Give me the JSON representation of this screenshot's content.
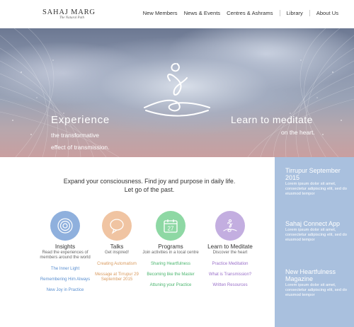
{
  "header": {
    "logo_main": "SAHAJ MARG",
    "logo_sub": "The Natural Path",
    "nav": [
      "New Members",
      "News & Events",
      "Centres & Ashrams",
      "Library",
      "About Us"
    ]
  },
  "hero": {
    "experience": "Experience",
    "experience_line1": "the transformative",
    "experience_line2": "effect of transmission.",
    "learn": "Learn to meditate",
    "learn_sub": "on the heart."
  },
  "intro": {
    "line1": "Expand your consciousness. Find joy and purpose in daily life.",
    "line2": "Let go of the past."
  },
  "columns": [
    {
      "title": "Insights",
      "sub": "Read the experiences of members around the world",
      "icon": "insight-icon",
      "color": "#8fb0dd",
      "link_color": "#5a8fd0",
      "links": [
        "The Inner Light",
        "Remembering Him Always",
        "New Joy in Practice"
      ]
    },
    {
      "title": "Talks",
      "sub": "Get inspired!",
      "icon": "speech-bubble-icon",
      "color": "#f0c4a2",
      "link_color": "#d99a5e",
      "links": [
        "Creating Automatism",
        "Message at Tirrupur 29 September 2015"
      ]
    },
    {
      "title": "Programs",
      "sub": "Join activities in a local centre",
      "icon": "calendar-icon",
      "color": "#8ed8a4",
      "link_color": "#4ab56e",
      "calendar_day": "27",
      "links": [
        "Sharing Heartfulness",
        "Becoming like the Master",
        "Attuning your Practice"
      ]
    },
    {
      "title": "Learn to Meditate",
      "sub": "Discover the heart",
      "icon": "meditation-icon",
      "color": "#c3aee0",
      "link_color": "#9a70c9",
      "links": [
        "Practice Meditation",
        "What is Transmission?",
        "Written Resources"
      ]
    }
  ],
  "sidebar": [
    {
      "title": "Tirrupur September 2015",
      "text": "Lorem ipsum dolor sit amet, consectetur adipiscing elit, sed do eiusmod tempor"
    },
    {
      "title": "Sahaj Connect App",
      "text": "Lorem ipsum dolor sit amet, consectetur adipiscing elit, sed do eiusmod tempor"
    },
    {
      "title": "New Heartfulness Magazine",
      "text": "Lorem ipsum dolor sit amet, consectetur adipiscing elit, sed do eiusmod tempor"
    }
  ]
}
